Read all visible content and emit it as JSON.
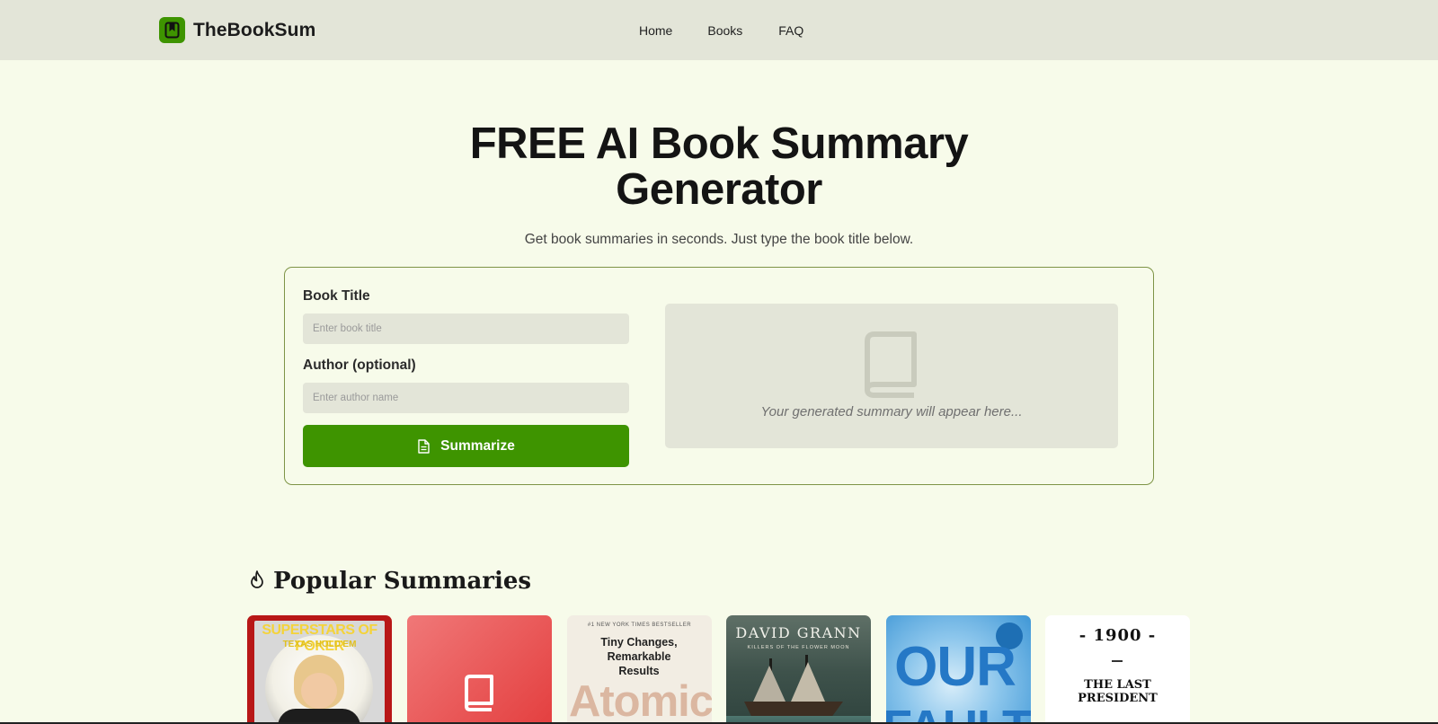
{
  "brand": {
    "name": "TheBookSum",
    "accent_color": "#3e9400",
    "logo_icon": "bookmark-icon"
  },
  "nav": {
    "items": [
      "Home",
      "Books",
      "FAQ"
    ]
  },
  "hero": {
    "title_line1": "FREE AI Book Summary",
    "title_line2": "Generator",
    "subtitle": "Get book summaries in seconds. Just type the book title below."
  },
  "form": {
    "title_label": "Book Title",
    "title_placeholder": "Enter book title",
    "title_value": "",
    "author_label": "Author (optional)",
    "author_placeholder": "Enter author name",
    "author_value": "",
    "submit_label": "Summarize",
    "submit_icon": "document-icon"
  },
  "output": {
    "icon": "book-icon",
    "placeholder": "Your generated summary will appear here..."
  },
  "popular": {
    "icon": "flame-icon",
    "title": "Popular Summaries",
    "books": [
      {
        "cover_line1": "SUPERSTARS OF POKER",
        "cover_line2": "TEXAS HOLD'EM"
      },
      {
        "cover_line1": "",
        "cover_line2": ""
      },
      {
        "cover_line1": "#1 NEW YORK TIMES BESTSELLER",
        "cover_line2": "Tiny Changes, Remarkable Results",
        "cover_line3": "Atomic"
      },
      {
        "cover_line1": "DAVID GRANN",
        "cover_line2": "KILLERS OF THE FLOWER MOON"
      },
      {
        "cover_line1": "OUR",
        "cover_line2": "FAULT"
      },
      {
        "cover_line1": "- 1900 -",
        "cover_line2": "THE LAST PRESIDENT"
      }
    ]
  }
}
